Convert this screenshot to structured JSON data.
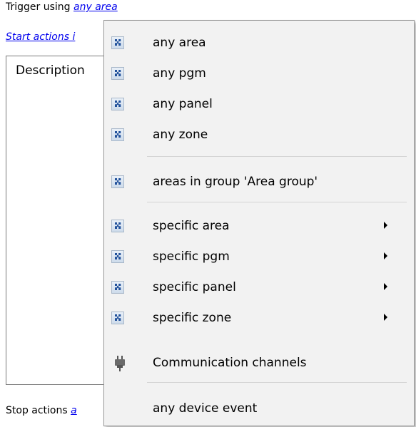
{
  "trigger": {
    "prefix": "Trigger using",
    "link": "any area"
  },
  "start_actions": {
    "link_visible": "Start actions i",
    "trailing": "a"
  },
  "description": {
    "label": "Description"
  },
  "stop_actions": {
    "prefix": "Stop actions",
    "link_visible": "a"
  },
  "menu": {
    "group1": [
      {
        "label": "any area",
        "icon": "puzzle-icon"
      },
      {
        "label": "any pgm",
        "icon": "puzzle-icon"
      },
      {
        "label": "any panel",
        "icon": "puzzle-icon"
      },
      {
        "label": "any zone",
        "icon": "puzzle-icon"
      }
    ],
    "group2": [
      {
        "label": "areas in group 'Area group'",
        "icon": "puzzle-icon"
      }
    ],
    "group3": [
      {
        "label": "specific area",
        "icon": "puzzle-icon",
        "submenu": true
      },
      {
        "label": "specific pgm",
        "icon": "puzzle-icon",
        "submenu": true
      },
      {
        "label": "specific panel",
        "icon": "puzzle-icon",
        "submenu": true
      },
      {
        "label": "specific zone",
        "icon": "puzzle-icon",
        "submenu": true
      }
    ],
    "group4": [
      {
        "label": "Communication channels",
        "icon": "plug-icon"
      }
    ],
    "group5": [
      {
        "label": "any device event"
      }
    ]
  },
  "colors": {
    "link": "#0000ee",
    "menu_bg": "#f2f2f2",
    "icon_blue": "#1f4f9a"
  }
}
